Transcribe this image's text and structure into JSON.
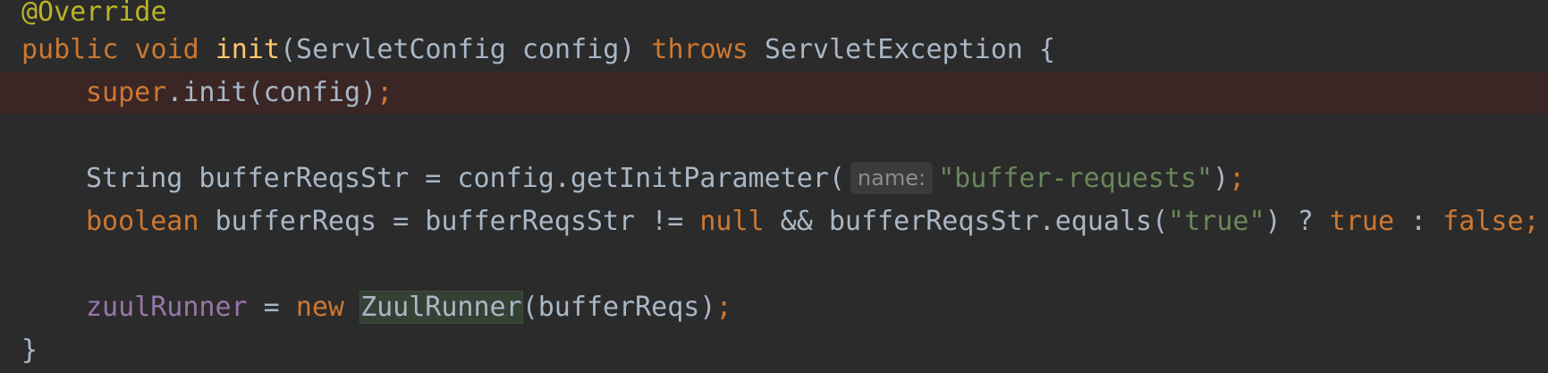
{
  "editor": {
    "lines": {
      "l1": {
        "annotation": "@Override"
      },
      "l2": {
        "kw_public": "public",
        "kw_void": "void",
        "method": "init",
        "params": "(ServletConfig config)",
        "kw_throws": "throws",
        "exception": "ServletException {"
      },
      "l3": {
        "kw_super": "super",
        "call": ".init(config)",
        "semi": ";"
      },
      "l5": {
        "type": "String bufferReqsStr = config.getInitParameter(",
        "hint": "name:",
        "str": "\"buffer-requests\"",
        "close": ")",
        "semi": ";"
      },
      "l6": {
        "kw_boolean": "boolean",
        "expr1": " bufferReqs = bufferReqsStr != ",
        "kw_null": "null",
        "expr2": " && bufferReqsStr.equals(",
        "str": "\"true\"",
        "expr3": ") ? ",
        "kw_true": "true",
        "expr4": " : ",
        "kw_false": "false",
        "semi": ";"
      },
      "l8": {
        "field": "zuulRunner",
        "eq": " = ",
        "kw_new": "new",
        "cls": "ZuulRunner",
        "args": "(bufferReqs)",
        "semi": ";"
      },
      "l9": {
        "brace": "}"
      }
    }
  },
  "colors": {
    "background": "#2b2b2b",
    "keyword": "#cc7832",
    "annotation": "#bbb529",
    "method": "#ffc66d",
    "string": "#6a8759",
    "field": "#9876aa",
    "text": "#a9b7c6",
    "breakpoint_line": "#3b2626"
  }
}
